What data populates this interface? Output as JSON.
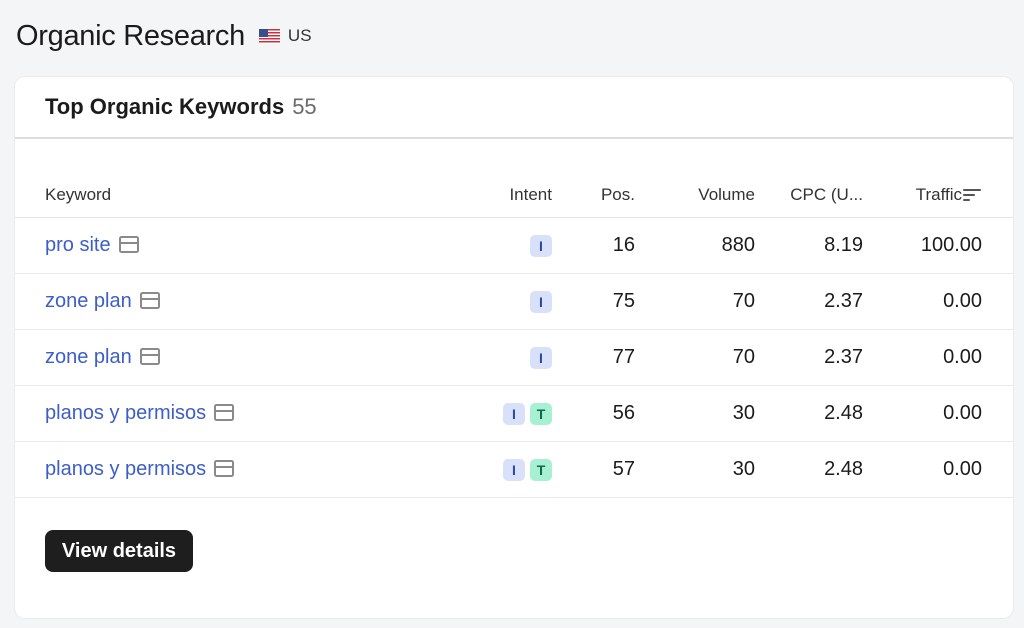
{
  "page": {
    "title": "Organic Research",
    "region": "US",
    "flag_icon": "us-flag-icon"
  },
  "card": {
    "title": "Top Organic Keywords",
    "count": "55"
  },
  "table": {
    "columns": [
      "Keyword",
      "Intent",
      "Pos.",
      "Volume",
      "CPC (U...",
      "Traffic"
    ],
    "rows": [
      {
        "keyword": "pro site",
        "intents": [
          "I"
        ],
        "pos": "16",
        "volume": "880",
        "cpc": "8.19",
        "traffic": "100.00"
      },
      {
        "keyword": "zone plan",
        "intents": [
          "I"
        ],
        "pos": "75",
        "volume": "70",
        "cpc": "2.37",
        "traffic": "0.00"
      },
      {
        "keyword": "zone plan",
        "intents": [
          "I"
        ],
        "pos": "77",
        "volume": "70",
        "cpc": "2.37",
        "traffic": "0.00"
      },
      {
        "keyword": "planos y permisos",
        "intents": [
          "I",
          "T"
        ],
        "pos": "56",
        "volume": "30",
        "cpc": "2.48",
        "traffic": "0.00"
      },
      {
        "keyword": "planos y permisos",
        "intents": [
          "I",
          "T"
        ],
        "pos": "57",
        "volume": "30",
        "cpc": "2.48",
        "traffic": "0.00"
      }
    ]
  },
  "actions": {
    "view_details_label": "View details"
  },
  "colors": {
    "link": "#3c5ec9",
    "intent_informational_bg": "#d8e0fa",
    "intent_transactional_bg": "#a7f0d4",
    "button_bg": "#1e1e1e"
  }
}
